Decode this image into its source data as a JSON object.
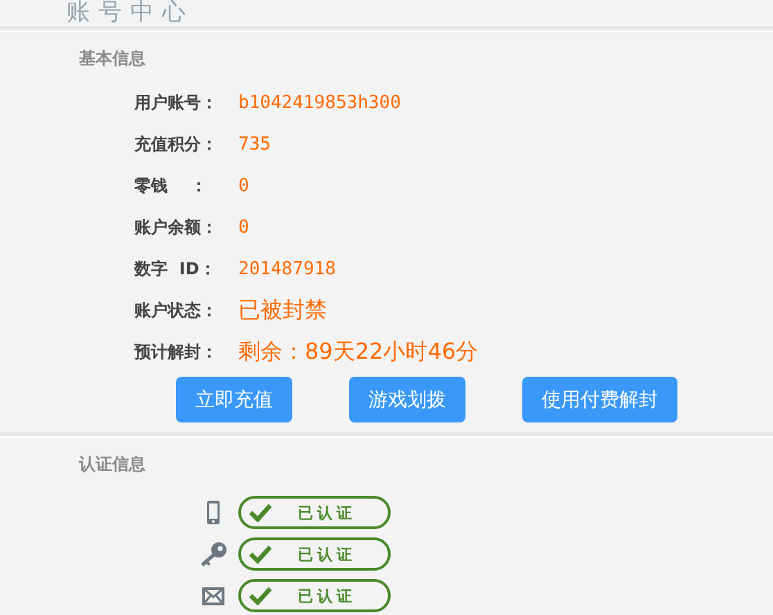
{
  "title": "账号中心",
  "basic": {
    "heading": "基本信息",
    "rows": [
      {
        "label": "用户账号：",
        "value": "b1042419853h300",
        "kind": "plain"
      },
      {
        "label": "充值积分：",
        "value": "735",
        "kind": "plain"
      },
      {
        "label": "零钱    ：",
        "value": "0",
        "kind": "plain"
      },
      {
        "label": "账户余额：",
        "value": "0",
        "kind": "plain"
      },
      {
        "label": "数字  ID：",
        "value": "201487918",
        "kind": "plain"
      },
      {
        "label": "账户状态：",
        "value": "已被封禁",
        "kind": "large"
      },
      {
        "label": "预计解封：",
        "value": "剩余：89天22小时46分",
        "kind": "large"
      }
    ],
    "buttons": [
      "立即充值",
      "游戏划拨",
      "使用付费解封"
    ]
  },
  "auth": {
    "heading": "认证信息",
    "items": [
      {
        "kind": "phone",
        "status": "已认证",
        "verified": true
      },
      {
        "kind": "key",
        "status": "已认证",
        "verified": true
      },
      {
        "kind": "mail",
        "status": "已认证",
        "verified": true
      }
    ]
  }
}
